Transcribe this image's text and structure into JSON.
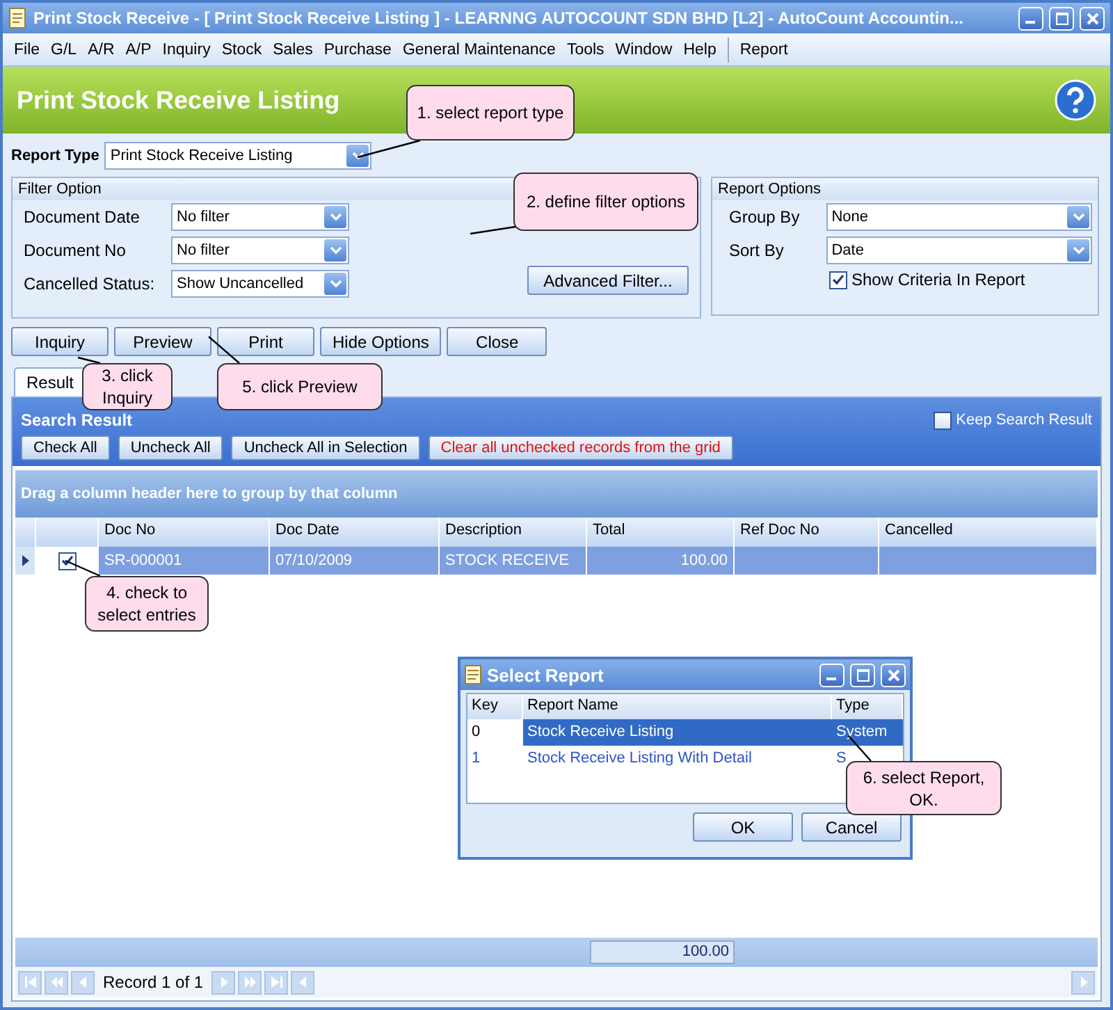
{
  "window": {
    "title": "Print Stock Receive - [ Print Stock Receive Listing ] - LEARNNG AUTOCOUNT SDN BHD [L2] - AutoCount Accountin..."
  },
  "menu": {
    "items": [
      "File",
      "G/L",
      "A/R",
      "A/P",
      "Inquiry",
      "Stock",
      "Sales",
      "Purchase",
      "General Maintenance",
      "Tools",
      "Window",
      "Help"
    ],
    "extra": [
      "Report"
    ]
  },
  "header": {
    "title": "Print Stock Receive Listing"
  },
  "report_type": {
    "label": "Report Type",
    "value": "Print Stock Receive Listing"
  },
  "filter_option": {
    "title": "Filter Option",
    "fields": [
      {
        "label": "Document Date",
        "value": "No filter"
      },
      {
        "label": "Document No",
        "value": "No filter"
      },
      {
        "label": "Cancelled Status:",
        "value": "Show Uncancelled"
      }
    ],
    "button": "Advanced Filter..."
  },
  "report_options": {
    "title": "Report Options",
    "fields": [
      {
        "label": "Group By",
        "value": "None"
      },
      {
        "label": "Sort By",
        "value": "Date"
      }
    ],
    "checkbox": {
      "label": "Show Criteria In Report",
      "checked": true
    }
  },
  "actions": [
    "Inquiry",
    "Preview",
    "Print",
    "Hide Options",
    "Close"
  ],
  "tabs": [
    {
      "label": "Result",
      "selected": true
    }
  ],
  "search_result": {
    "title": "Search Result",
    "keep": {
      "label": "Keep Search Result",
      "checked": false
    },
    "buttons": [
      {
        "label": "Check All",
        "kind": "normal"
      },
      {
        "label": "Uncheck All",
        "kind": "normal"
      },
      {
        "label": "Uncheck All in Selection",
        "kind": "normal"
      },
      {
        "label": "Clear all unchecked records from the grid",
        "kind": "warning"
      }
    ],
    "group_hint": "Drag a column header here to group by that column"
  },
  "table": {
    "columns": [
      "Doc No",
      "Doc Date",
      "Description",
      "Total",
      "Ref Doc No",
      "Cancelled"
    ],
    "rows": [
      {
        "selected": true,
        "checked": true,
        "cells": [
          "SR-000001",
          "07/10/2009",
          "STOCK RECEIVE",
          "100.00",
          "",
          ""
        ]
      }
    ],
    "footer_total": "100.00",
    "record": "Record 1 of 1"
  },
  "dialog": {
    "title": "Select Report",
    "columns": [
      "Key",
      "Report Name",
      "Type"
    ],
    "rows": [
      {
        "selected": true,
        "cells": [
          "0",
          "Stock Receive Listing",
          "System"
        ]
      },
      {
        "selected": false,
        "cells": [
          "1",
          "Stock Receive Listing With Detail",
          "S"
        ]
      }
    ],
    "buttons": [
      "OK",
      "Cancel"
    ]
  },
  "callouts": [
    {
      "text": "1. select report type"
    },
    {
      "text": "2. define filter options"
    },
    {
      "text": "3. click Inquiry"
    },
    {
      "text": "4. check to select entries"
    },
    {
      "text": "5. click Preview"
    },
    {
      "text": "6. select Report, OK."
    }
  ]
}
